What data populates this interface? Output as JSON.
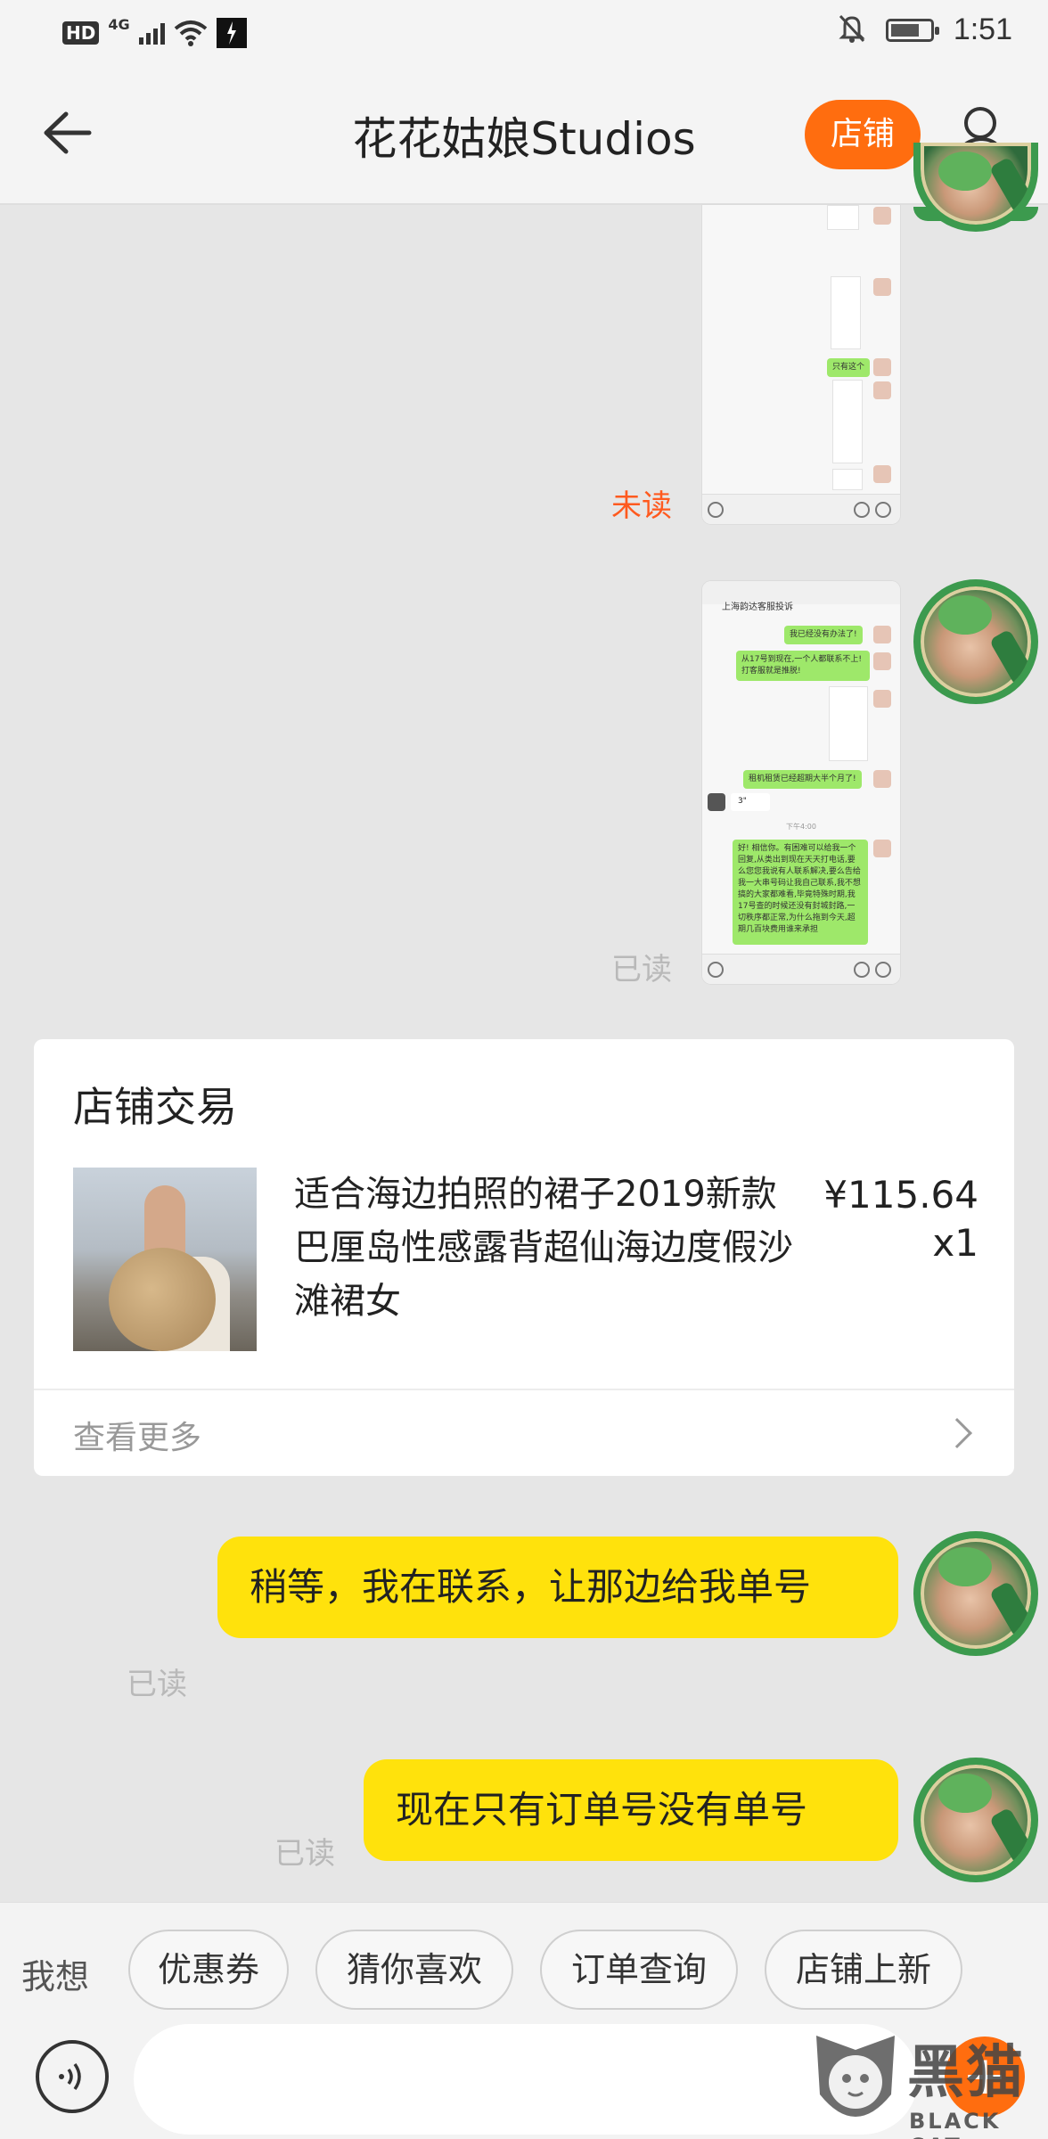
{
  "status_bar": {
    "hd": "HD",
    "network": "4G",
    "time": "1:51"
  },
  "nav": {
    "title": "花花姑娘Studios",
    "shop_button": "店铺",
    "icons": {
      "back": "back-arrow-icon",
      "settings": "person-settings-icon"
    }
  },
  "messages": {
    "msg1_status": "未读",
    "msg2_status": "已读",
    "msg2_screenshot": {
      "header": "上海韵达客服投诉",
      "bubbles": [
        "我已经没有办法了!",
        "从17号到现在,一个人都联系不上! 打客服就是推脱!",
        "租机租赁已经超期大半个月了!",
        "好! 相信你。有困难可以给我一个回复,从类出到现在天天打电话,要么您您我说有人联系解决,要么告给我一大串号码让我自己联系,我不想搞的大家都难看,毕竟特殊时期,我17号查的时候还没有封城封路,一切秩序都正常,为什么拖到今天,超期几百块费用谁来承担"
      ],
      "voice": "3\"",
      "time_label": "下午4:00"
    },
    "msg1_screenshot": {
      "bubble": "只有这个"
    },
    "order_card": {
      "title": "店铺交易",
      "product_name": "适合海边拍照的裙子2019新款巴厘岛性感露背超仙海边度假沙滩裙女",
      "price": "¥115.64",
      "quantity": "x1",
      "see_more": "查看更多"
    },
    "msg3_text": "稍等，我在联系，让那边给我单号",
    "msg3_status": "已读",
    "msg4_text": "现在只有订单号没有单号",
    "msg4_status": "已读"
  },
  "quick_bar": {
    "label": "我想",
    "chips": [
      "优惠券",
      "猜你喜欢",
      "订单查询",
      "店铺上新"
    ]
  },
  "input": {
    "plus": "+",
    "icons": {
      "voice": "voice-icon"
    }
  },
  "watermark": {
    "cn": "黑猫",
    "en": "BLACK CAT"
  },
  "colors": {
    "accent": "#ff6d0f",
    "bubble": "#ffe20c",
    "unread": "#ff5a1f",
    "read": "#b9b9b9"
  }
}
